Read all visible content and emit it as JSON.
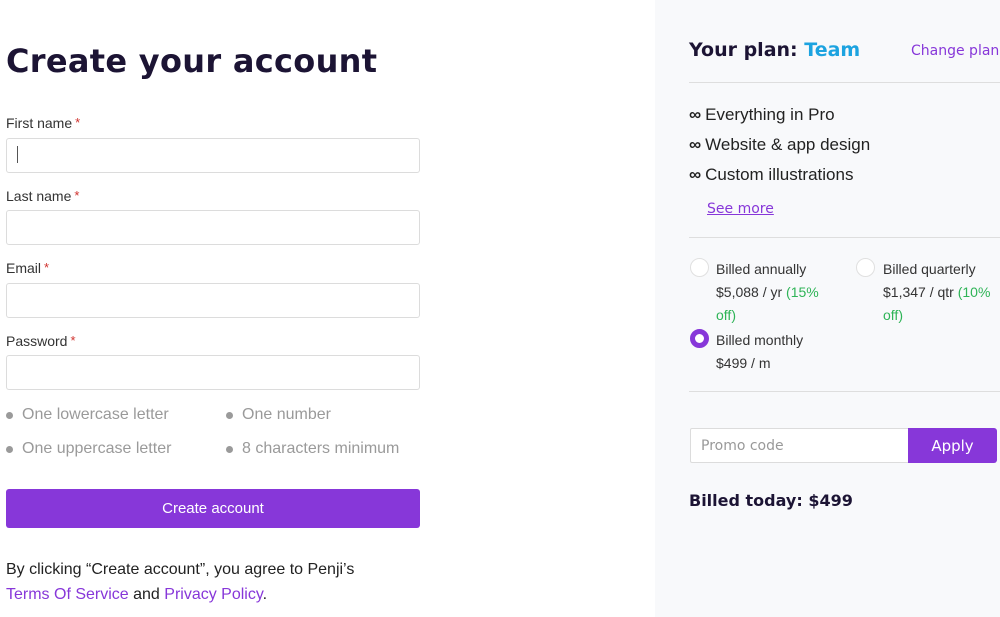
{
  "signup": {
    "title": "Create your account",
    "fields": [
      {
        "label": "First name",
        "required_mark": "*",
        "value": "",
        "placeholder": ""
      },
      {
        "label": "Last name",
        "required_mark": "*",
        "value": "",
        "placeholder": ""
      },
      {
        "label": "Email",
        "required_mark": "*",
        "value": "",
        "placeholder": ""
      },
      {
        "label": "Password",
        "required_mark": "*",
        "value": "",
        "placeholder": ""
      }
    ],
    "password_rules": [
      "One lowercase letter",
      "One number",
      "One uppercase letter",
      "8 characters minimum"
    ],
    "submit_label": "Create account",
    "agreement": {
      "prefix": "By clicking “Create account”, you agree to Penji’s",
      "terms_link": "Terms Of Service",
      "conjunction": " and ",
      "privacy_link": "Privacy Policy",
      "suffix": "."
    }
  },
  "plan": {
    "title_prefix": "Your plan: ",
    "plan_name": "Team",
    "change_plan_label": "Change plan",
    "feature_icon": "infinity-icon",
    "features": [
      "Everything in Pro",
      "Website & app design",
      "Custom illustrations"
    ],
    "see_more_label": "See more",
    "billing_options": [
      {
        "label": "Billed annually",
        "price": "$5,088 / yr",
        "discount": "(15% off)",
        "selected": false
      },
      {
        "label": "Billed quarterly",
        "price": "$1,347 / qtr",
        "discount": "(10% off)",
        "selected": false
      },
      {
        "label": "Billed monthly",
        "price": "$499 / m",
        "discount": "",
        "selected": true
      }
    ],
    "promo_placeholder": "Promo code",
    "promo_value": "",
    "apply_label": "Apply",
    "billed_today": "Billed today: $499"
  },
  "colors": {
    "accent": "#8737d9",
    "plan_name": "#1ca3e0",
    "discount": "#2fb457",
    "required": "#d0312d",
    "heading": "#1c1434"
  }
}
